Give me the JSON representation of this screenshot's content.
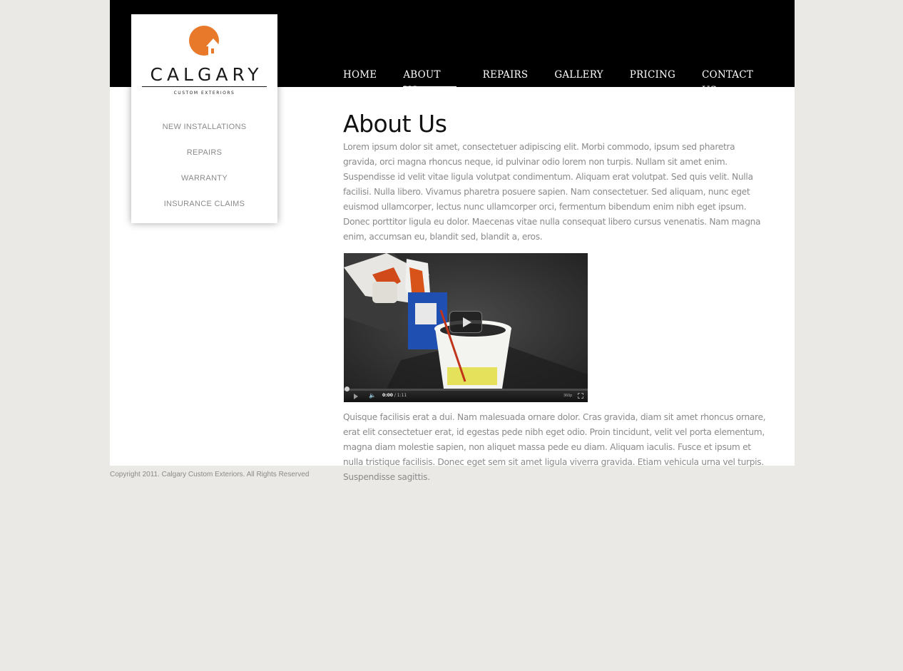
{
  "brand": {
    "name": "CALGARY",
    "tagline": "CUSTOM EXTERIORS",
    "accent_color": "#e8782a"
  },
  "main_nav": {
    "items": [
      {
        "label": "HOME"
      },
      {
        "label": "ABOUT US",
        "active": true
      },
      {
        "label": "REPAIRS"
      },
      {
        "label": "GALLERY"
      },
      {
        "label": "PRICING"
      },
      {
        "label": "CONTACT US"
      }
    ]
  },
  "side_nav": {
    "items": [
      {
        "label": "NEW INSTALLATIONS"
      },
      {
        "label": "REPAIRS"
      },
      {
        "label": "WARRANTY"
      },
      {
        "label": "INSURANCE CLAIMS"
      }
    ]
  },
  "content": {
    "title": "About Us",
    "paragraph_1": "Lorem ipsum dolor sit amet, consectetuer adipiscing elit. Morbi commodo, ipsum sed pharetra gravida, orci magna rhoncus neque, id pulvinar odio lorem non turpis. Nullam sit amet enim. Suspendisse id velit vitae ligula volutpat condimentum. Aliquam erat volutpat. Sed quis velit. Nulla facilisi. Nulla libero. Vivamus pharetra posuere sapien. Nam consectetuer. Sed aliquam, nunc eget euismod ullamcorper, lectus nunc ullamcorper orci, fermentum bibendum enim nibh eget ipsum. Donec porttitor ligula eu dolor. Maecenas vitae nulla consequat libero cursus venenatis. Nam magna enim, accumsan eu, blandit sed, blandit a, eros.",
    "paragraph_2": "Quisque facilisis erat a dui. Nam malesuada ornare dolor. Cras gravida, diam sit amet rhoncus ornare, erat elit consectetuer erat, id egestas pede nibh eget odio. Proin tincidunt, velit vel porta elementum, magna diam molestie sapien, non aliquet massa pede eu diam. Aliquam iaculis. Fusce et ipsum et nulla tristique facilisis. Donec eget sem sit amet ligula viverra gravida. Etiam vehicula urna vel turpis. Suspendisse sagittis."
  },
  "video": {
    "current_time": "0:00",
    "duration": "/ 1:11",
    "quality": "360p",
    "progress": 0,
    "icons": [
      "play-icon",
      "volume-icon",
      "fullscreen-icon"
    ]
  },
  "footer": {
    "copyright": "Copyright 2011. Calgary Custom Exteriors. All Rights Reserved"
  }
}
